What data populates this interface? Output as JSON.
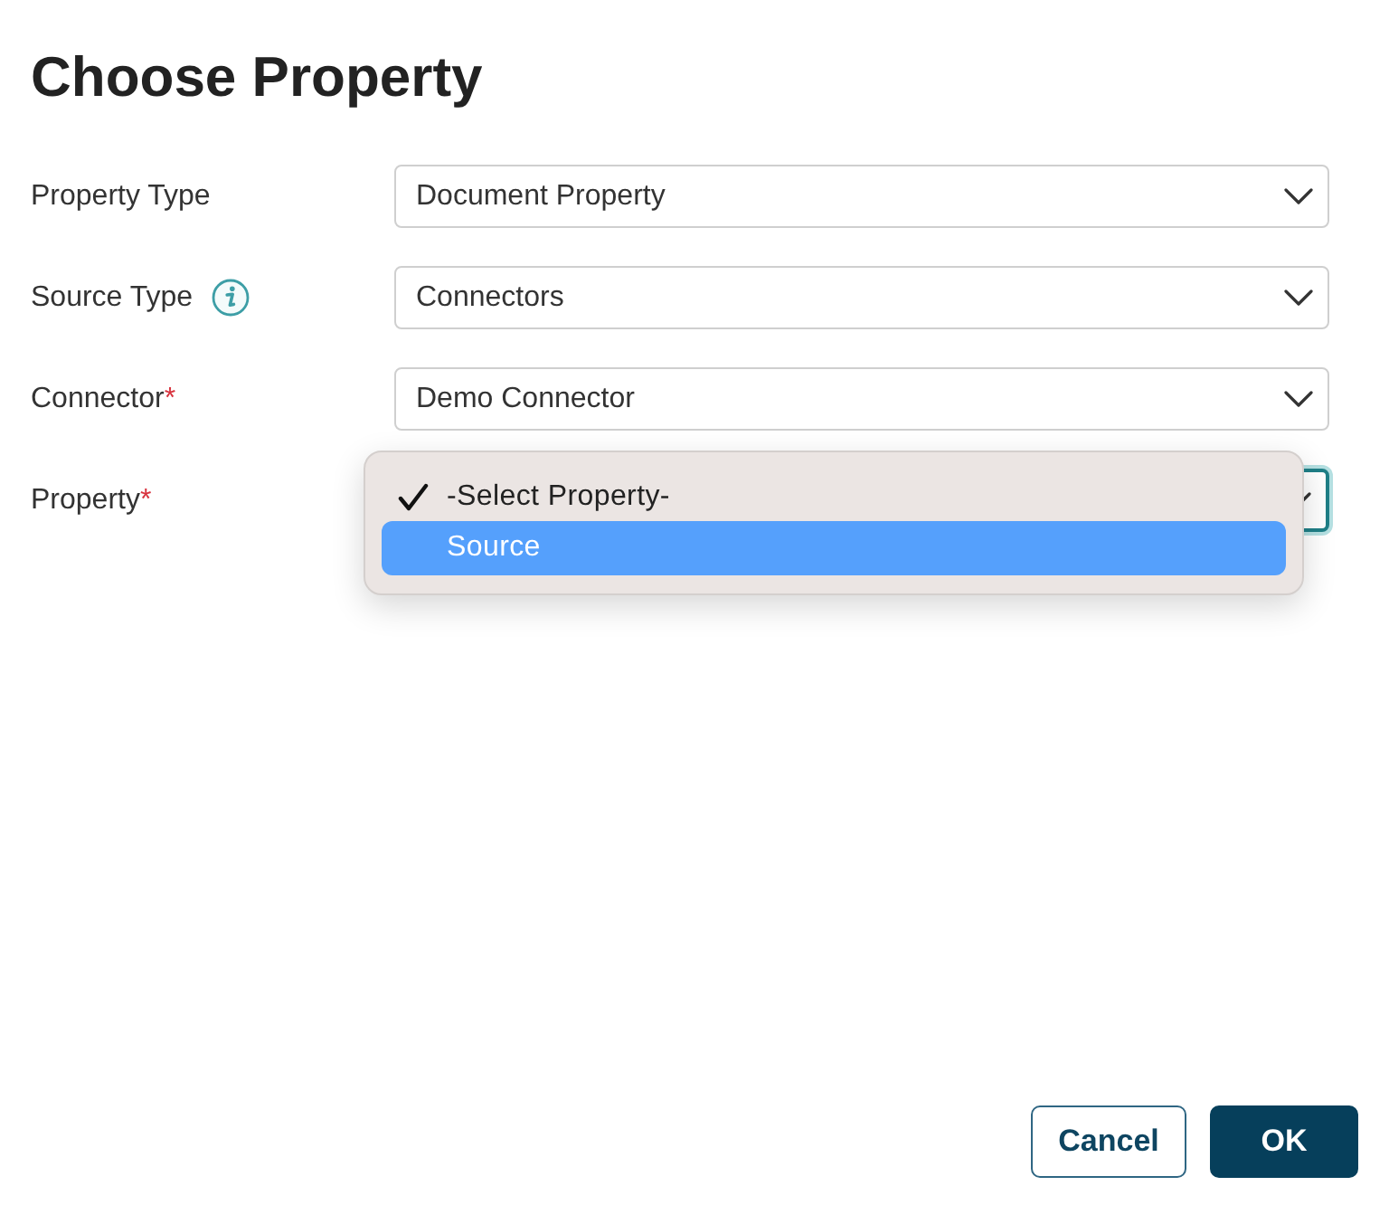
{
  "dialog": {
    "title": "Choose Property"
  },
  "fields": [
    {
      "label": "Property Type",
      "value": "Document Property",
      "focused": false
    },
    {
      "label": "Source Type",
      "value": "Connectors",
      "info_icon": true,
      "focused": false
    },
    {
      "label": "Connector",
      "marker": "*",
      "value": "Demo Connector",
      "focused": false
    },
    {
      "label": "Property",
      "marker": "*",
      "focused": true,
      "options": [
        {
          "label": "-Select Property-",
          "selected": true,
          "highlighted": false
        },
        {
          "label": "Source",
          "selected": false,
          "highlighted": true
        }
      ]
    }
  ],
  "buttons": [
    {
      "label": "Cancel",
      "kind": "secondary"
    },
    {
      "label": "OK",
      "kind": "primary"
    }
  ]
}
